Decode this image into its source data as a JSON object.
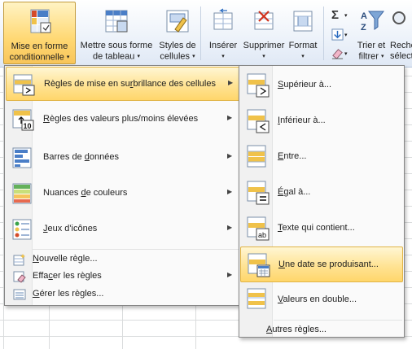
{
  "ribbon": {
    "buttons": [
      {
        "line1": "Mise en forme",
        "line2": "conditionnelle"
      },
      {
        "line1": "Mettre sous forme",
        "line2": "de tableau"
      },
      {
        "line1": "Styles de",
        "line2": "cellules"
      },
      {
        "line1": "Insérer",
        "line2": ""
      },
      {
        "line1": "Supprimer",
        "line2": ""
      },
      {
        "line1": "Format",
        "line2": ""
      },
      {
        "line1": "Trier et",
        "line2": "filtrer"
      },
      {
        "line1": "Reche",
        "line2": "sélect"
      }
    ],
    "sigma": "Σ",
    "dropdown_caret": "▾"
  },
  "menu": {
    "items": [
      {
        "label_pre": "Règles de mise en su",
        "label_key": "r",
        "label_post": "brillance des cellules",
        "icon": "highlight-cells-rules-icon",
        "submenu": true
      },
      {
        "label_pre": "",
        "label_key": "R",
        "label_post": "ègles des valeurs plus/moins élevées",
        "icon": "top-bottom-rules-icon",
        "submenu": true
      },
      {
        "label_pre": "Barres de ",
        "label_key": "d",
        "label_post": "onnées",
        "icon": "data-bars-icon",
        "submenu": true
      },
      {
        "label_pre": "Nuances ",
        "label_key": "d",
        "label_post": "e couleurs",
        "icon": "color-scales-icon",
        "submenu": true
      },
      {
        "label_pre": "",
        "label_key": "J",
        "label_post": "eux d'icônes",
        "icon": "icon-sets-icon",
        "submenu": true
      }
    ],
    "small_items": [
      {
        "label_pre": "",
        "label_key": "N",
        "label_post": "ouvelle règle...",
        "icon": "new-rule-icon",
        "submenu": false
      },
      {
        "label_pre": "Effa",
        "label_key": "c",
        "label_post": "er les règles",
        "icon": "clear-rules-icon",
        "submenu": true
      },
      {
        "label_pre": "",
        "label_key": "G",
        "label_post": "érer les règles...",
        "icon": "manage-rules-icon",
        "submenu": false
      }
    ],
    "arrow_glyph": "▶"
  },
  "submenu": {
    "items": [
      {
        "label_pre": "",
        "label_key": "S",
        "label_post": "upérieur à...",
        "icon": "greater-than-icon"
      },
      {
        "label_pre": "",
        "label_key": "I",
        "label_post": "nférieur à...",
        "icon": "less-than-icon"
      },
      {
        "label_pre": "",
        "label_key": "E",
        "label_post": "ntre...",
        "icon": "between-icon"
      },
      {
        "label_pre": "",
        "label_key": "É",
        "label_post": "gal à...",
        "icon": "equal-to-icon"
      },
      {
        "label_pre": "",
        "label_key": "T",
        "label_post": "exte qui contient...",
        "icon": "text-contains-icon"
      },
      {
        "label_pre": "",
        "label_key": "U",
        "label_post": "ne date se produisant...",
        "icon": "date-occurring-icon"
      },
      {
        "label_pre": "",
        "label_key": "V",
        "label_post": "aleurs en double...",
        "icon": "duplicate-values-icon"
      }
    ],
    "more_rules": {
      "label_pre": "",
      "label_key": "A",
      "label_post": "utres règles..."
    }
  }
}
